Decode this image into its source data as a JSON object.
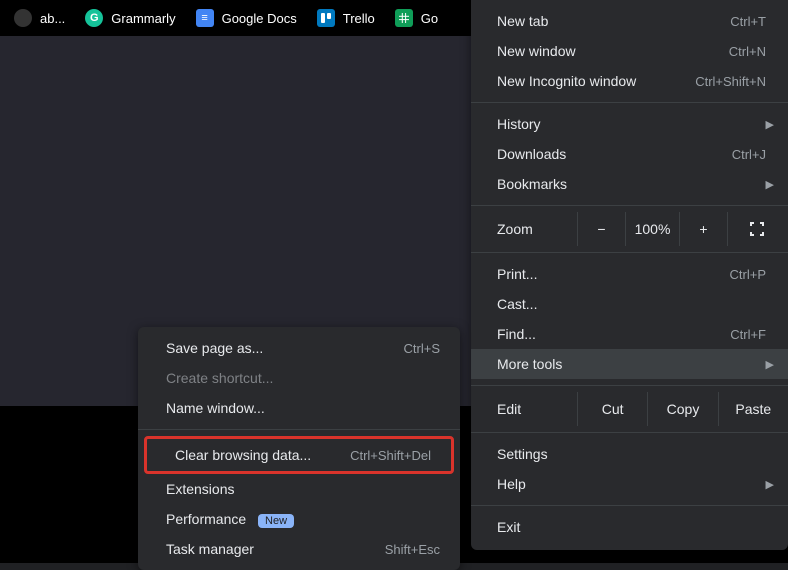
{
  "bookmarks": [
    {
      "label": "ab...",
      "icon_bg": "#333",
      "icon_fg": "#fff",
      "icon_letter": ""
    },
    {
      "label": "Grammarly",
      "icon_bg": "#15c39a",
      "icon_fg": "#fff",
      "icon_letter": "G"
    },
    {
      "label": "Google Docs",
      "icon_bg": "#4285f4",
      "icon_fg": "#fff",
      "icon_letter": "≡"
    },
    {
      "label": "Trello",
      "icon_bg": "#0079bf",
      "icon_fg": "#fff",
      "icon_letter": "📋"
    },
    {
      "label": "Go",
      "icon_bg": "#0f9d58",
      "icon_fg": "#fff",
      "icon_letter": "▦"
    }
  ],
  "main_menu": {
    "new_tab": {
      "label": "New tab",
      "shortcut": "Ctrl+T"
    },
    "new_window": {
      "label": "New window",
      "shortcut": "Ctrl+N"
    },
    "new_incognito": {
      "label": "New Incognito window",
      "shortcut": "Ctrl+Shift+N"
    },
    "history": {
      "label": "History"
    },
    "downloads": {
      "label": "Downloads",
      "shortcut": "Ctrl+J"
    },
    "bookmarks": {
      "label": "Bookmarks"
    },
    "zoom": {
      "label": "Zoom",
      "minus": "−",
      "value": "100%",
      "plus": "+"
    },
    "print": {
      "label": "Print...",
      "shortcut": "Ctrl+P"
    },
    "cast": {
      "label": "Cast..."
    },
    "find": {
      "label": "Find...",
      "shortcut": "Ctrl+F"
    },
    "more_tools": {
      "label": "More tools"
    },
    "edit": {
      "label": "Edit",
      "cut": "Cut",
      "copy": "Copy",
      "paste": "Paste"
    },
    "settings": {
      "label": "Settings"
    },
    "help": {
      "label": "Help"
    },
    "exit": {
      "label": "Exit"
    }
  },
  "sub_menu": {
    "save_page": {
      "label": "Save page as...",
      "shortcut": "Ctrl+S"
    },
    "create_shortcut": {
      "label": "Create shortcut..."
    },
    "name_window": {
      "label": "Name window..."
    },
    "clear_data": {
      "label": "Clear browsing data...",
      "shortcut": "Ctrl+Shift+Del"
    },
    "extensions": {
      "label": "Extensions"
    },
    "performance": {
      "label": "Performance",
      "badge": "New"
    },
    "task_manager": {
      "label": "Task manager",
      "shortcut": "Shift+Esc"
    }
  }
}
